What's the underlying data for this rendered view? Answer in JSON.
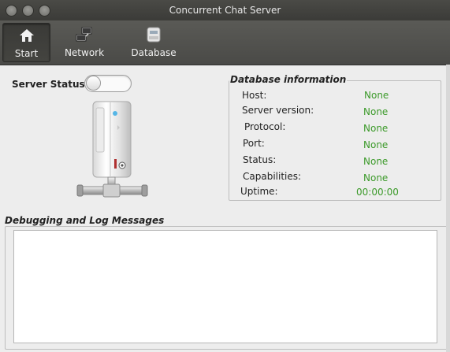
{
  "window": {
    "title": "Concurrent Chat Server"
  },
  "toolbar": {
    "items": [
      {
        "label": "Start",
        "icon": "home-icon",
        "active": true
      },
      {
        "label": "Network",
        "icon": "network-icon",
        "active": false
      },
      {
        "label": "Database",
        "icon": "database-icon",
        "active": false
      }
    ]
  },
  "server": {
    "status_label": "Server Status:",
    "status_on": false
  },
  "db_info": {
    "title": "Database information",
    "value_color": "#3c9a2a",
    "rows": [
      {
        "label": "Host:",
        "value": "None"
      },
      {
        "label": "Server version:",
        "value": "None"
      },
      {
        "label": "Protocol:",
        "value": "None"
      },
      {
        "label": "Port:",
        "value": "None"
      },
      {
        "label": "Status:",
        "value": "None"
      },
      {
        "label": "Capabilities:",
        "value": "None"
      },
      {
        "label": "Uptime:",
        "value": "00:00:00"
      }
    ]
  },
  "log": {
    "title": "Debugging and Log Messages",
    "content": ""
  }
}
